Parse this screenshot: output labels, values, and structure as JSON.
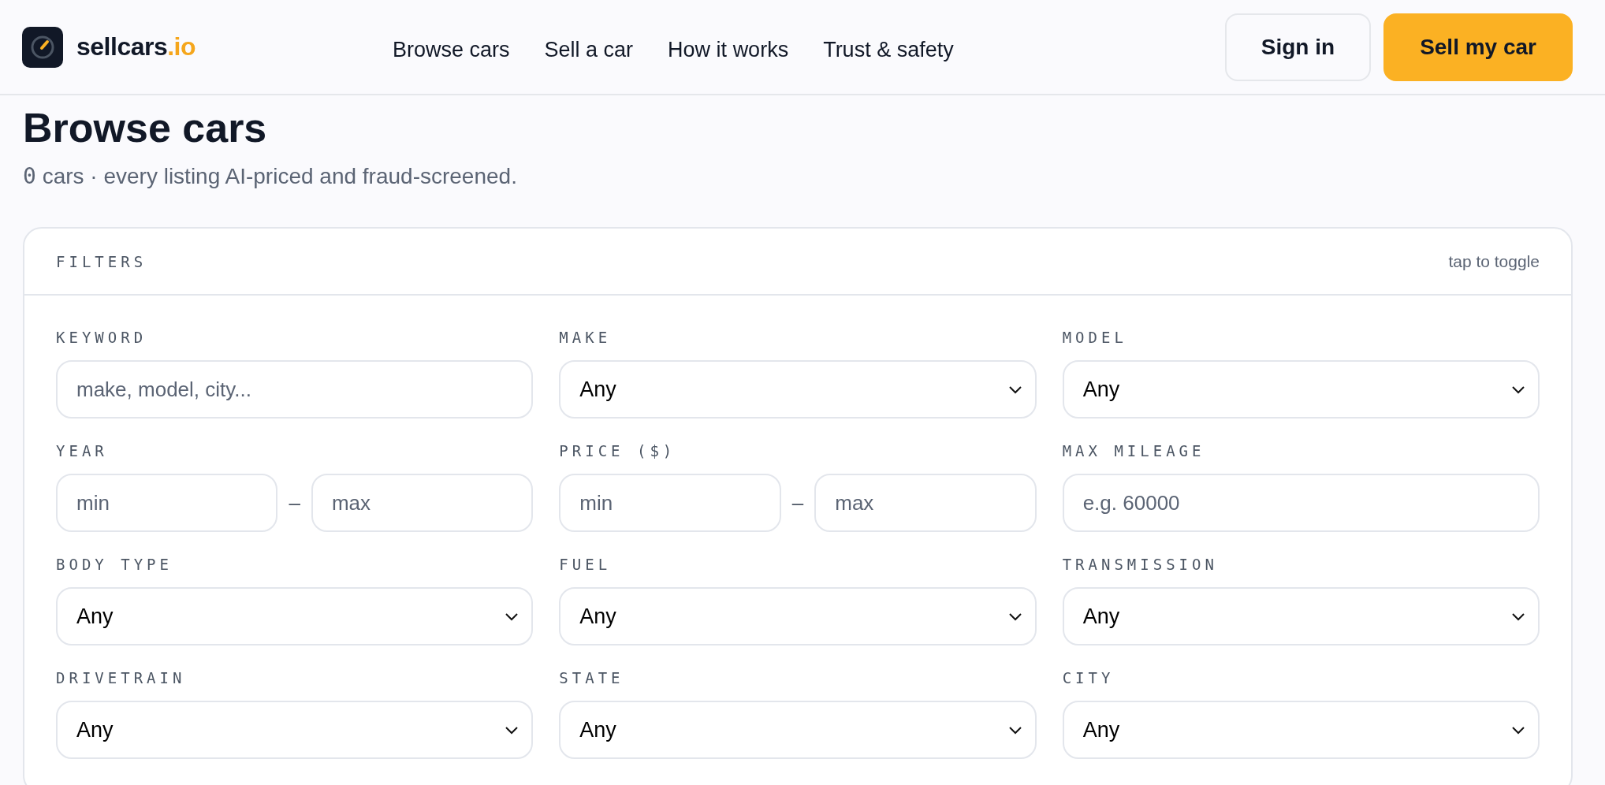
{
  "brand": {
    "name": "sellcars",
    "suffix": ".io"
  },
  "nav": [
    {
      "label": "Browse cars"
    },
    {
      "label": "Sell a car"
    },
    {
      "label": "How it works"
    },
    {
      "label": "Trust & safety"
    }
  ],
  "actions": [
    {
      "label": "Sign in",
      "kind": "secondary"
    },
    {
      "label": "Sell my car",
      "kind": "primary"
    }
  ],
  "page": {
    "title": "Browse cars",
    "count": "0",
    "subtitle": "cars · every listing AI-priced and fraud-screened."
  },
  "filters": {
    "title": "FILTERS",
    "hint": "tap to toggle",
    "fields": [
      {
        "label": "KEYWORD",
        "kind": "text",
        "placeholder": "make, model, city..."
      },
      {
        "label": "MAKE",
        "kind": "select",
        "value": "Any"
      },
      {
        "label": "MODEL",
        "kind": "select",
        "value": "Any"
      },
      {
        "label": "YEAR",
        "kind": "range",
        "min_placeholder": "min",
        "separator": "–",
        "max_placeholder": "max"
      },
      {
        "label": "PRICE ($)",
        "kind": "range",
        "min_placeholder": "min",
        "separator": "–",
        "max_placeholder": "max"
      },
      {
        "label": "MAX MILEAGE",
        "kind": "text",
        "placeholder": "e.g. 60000"
      },
      {
        "label": "BODY TYPE",
        "kind": "select",
        "value": "Any"
      },
      {
        "label": "FUEL",
        "kind": "select",
        "value": "Any"
      },
      {
        "label": "TRANSMISSION",
        "kind": "select",
        "value": "Any"
      },
      {
        "label": "DRIVETRAIN",
        "kind": "select",
        "value": "Any"
      },
      {
        "label": "STATE",
        "kind": "select",
        "value": "Any"
      },
      {
        "label": "CITY",
        "kind": "select",
        "value": "Any"
      }
    ]
  }
}
